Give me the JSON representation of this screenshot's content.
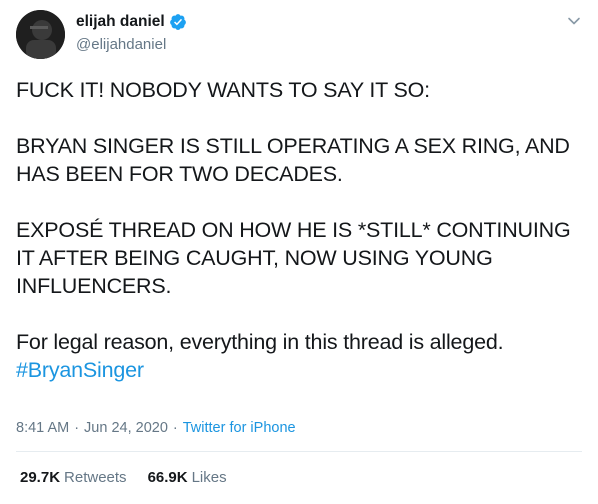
{
  "author": {
    "name": "elijah daniel",
    "handle": "@elijahdaniel",
    "verified": true
  },
  "tweet": {
    "paragraphs": [
      "FUCK IT! NOBODY WANTS TO SAY IT SO:",
      "BRYAN SINGER IS STILL OPERATING A SEX RING, AND HAS BEEN FOR TWO DECADES.",
      "EXPOSÉ THREAD ON HOW HE IS *STILL* CONTINUING IT AFTER BEING CAUGHT, NOW USING YOUNG INFLUENCERS.",
      "For legal reason, everything in this thread is alleged."
    ],
    "hashtag": "#BryanSinger"
  },
  "meta": {
    "time": "8:41 AM",
    "separator": "·",
    "date": "Jun 24, 2020",
    "source": "Twitter for iPhone"
  },
  "stats": {
    "retweets_count": "29.7K",
    "retweets_label": "Retweets",
    "likes_count": "66.9K",
    "likes_label": "Likes"
  },
  "icons": {
    "verified": "verified-badge-icon",
    "caret": "chevron-down-icon"
  },
  "colors": {
    "link": "#1b95e0",
    "verified": "#1da1f2",
    "muted": "#657786"
  }
}
